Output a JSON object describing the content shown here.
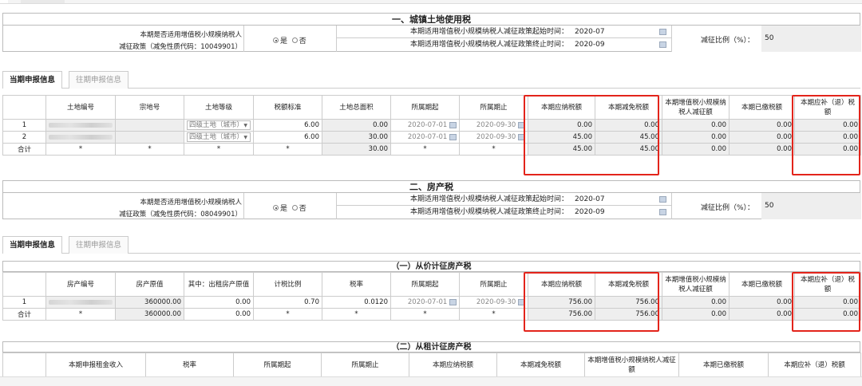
{
  "land_tax": {
    "title": "一、城镇土地使用税",
    "policy": {
      "question_line1": "本期是否适用增值税小规模纳税人",
      "question_line2": "减征政策（减免性质代码：10049901）",
      "yes": "是",
      "no": "否",
      "start_label": "本期适用增值税小规模纳税人减征政策起始时间：",
      "start_value": "2020-07",
      "end_label": "本期适用增值税小规模纳税人减征政策终止时间：",
      "end_value": "2020-09",
      "ratio_label": "减征比例（%）：",
      "ratio_value": "50"
    },
    "tabs": [
      "当期申报信息",
      "往期申报信息"
    ],
    "headers": [
      "",
      "土地编号",
      "宗地号",
      "土地等级",
      "税额标准",
      "土地总面积",
      "所属期起",
      "所属期止",
      "本期应纳税额",
      "本期减免税额",
      "本期增值税小规模纳税人减征额",
      "本期已缴税额",
      "本期应补（退）税额"
    ],
    "rows": [
      {
        "idx": "1",
        "grade": "四级土地（城市）",
        "standard": "6.00",
        "area": "0.00",
        "from": "2020-07-01",
        "to": "2020-09-30",
        "due": "0.00",
        "exempt": "0.00",
        "small": "0.00",
        "paid": "0.00",
        "balance": "0.00"
      },
      {
        "idx": "2",
        "grade": "四级土地（城市）",
        "standard": "6.00",
        "area": "30.00",
        "from": "2020-07-01",
        "to": "2020-09-30",
        "due": "45.00",
        "exempt": "45.00",
        "small": "0.00",
        "paid": "0.00",
        "balance": "0.00"
      }
    ],
    "total": {
      "label": "合计",
      "star": "*",
      "area": "30.00",
      "due": "45.00",
      "exempt": "45.00",
      "small": "0.00",
      "paid": "0.00",
      "balance": "0.00"
    }
  },
  "property_tax": {
    "title": "二、房产税",
    "policy": {
      "question_line1": "本期是否适用增值税小规模纳税人",
      "question_line2": "减征政策（减免性质代码：08049901）",
      "yes": "是",
      "no": "否",
      "start_label": "本期适用增值税小规模纳税人减征政策起始时间：",
      "start_value": "2020-07",
      "end_label": "本期适用增值税小规模纳税人减征政策终止时间：",
      "end_value": "2020-09",
      "ratio_label": "减征比例（%）：",
      "ratio_value": "50"
    },
    "tabs": [
      "当期申报信息",
      "往期申报信息"
    ],
    "value_sub": {
      "title": "（一）从价计征房产税",
      "headers": [
        "",
        "房产编号",
        "房产原值",
        "其中：出租房产原值",
        "计税比例",
        "税率",
        "所属期起",
        "所属期止",
        "本期应纳税额",
        "本期减免税额",
        "本期增值税小规模纳税人减征额",
        "本期已缴税额",
        "本期应补（退）税额"
      ],
      "row": {
        "idx": "1",
        "orig": "360000.00",
        "rent": "0.00",
        "ratio": "0.70",
        "rate": "0.0120",
        "from": "2020-07-01",
        "to": "2020-09-30",
        "due": "756.00",
        "exempt": "756.00",
        "small": "0.00",
        "paid": "0.00",
        "balance": "0.00"
      },
      "total": {
        "label": "合计",
        "star": "*",
        "orig": "360000.00",
        "rent": "0.00",
        "due": "756.00",
        "exempt": "756.00",
        "small": "0.00",
        "paid": "0.00",
        "balance": "0.00"
      }
    },
    "rent_sub": {
      "title": "（二）从租计征房产税",
      "headers": [
        "",
        "本期申报租金收入",
        "税率",
        "所属期起",
        "所属期止",
        "本期应纳税额",
        "本期减免税额",
        "本期增值税小规模纳税人减征额",
        "本期已缴税额",
        "本期应补（退）税额"
      ]
    }
  },
  "colors": {
    "highlight": "#e3241b",
    "readonly": "#eeeeee",
    "border": "#cccccc"
  }
}
